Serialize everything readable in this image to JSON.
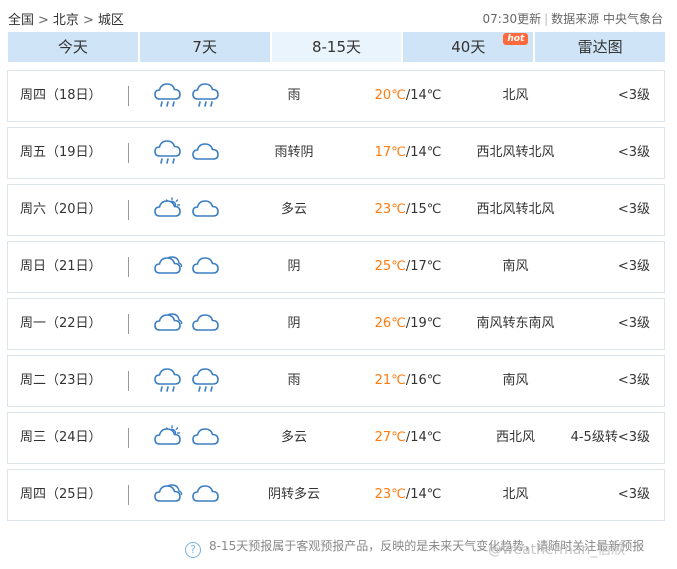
{
  "breadcrumb": {
    "items": [
      "全国",
      "北京",
      "城区"
    ],
    "sep": ">"
  },
  "meta": {
    "updated": "07:30更新",
    "source_label": "数据来源",
    "source": "中央气象台"
  },
  "tabs": [
    {
      "label": "今天",
      "active": false
    },
    {
      "label": "7天",
      "active": false
    },
    {
      "label": "8-15天",
      "active": true
    },
    {
      "label": "40天",
      "active": false,
      "badge": "hot"
    },
    {
      "label": "雷达图",
      "active": false
    }
  ],
  "days": [
    {
      "day": "周四（18日）",
      "icon1": "rain-cloud-icon",
      "icon2": "rain-cloud-icon",
      "weather": "雨",
      "high": "20℃",
      "low": "/14℃",
      "wind": "北风",
      "level": "<3级"
    },
    {
      "day": "周五（19日）",
      "icon1": "rain-cloud-icon",
      "icon2": "cloudy-night-icon",
      "weather": "雨转阴",
      "high": "17℃",
      "low": "/14℃",
      "wind": "西北风转北风",
      "level": "<3级"
    },
    {
      "day": "周六（20日）",
      "icon1": "partly-cloudy-day-icon",
      "icon2": "cloudy-night-icon",
      "weather": "多云",
      "high": "23℃",
      "low": "/15℃",
      "wind": "西北风转北风",
      "level": "<3级"
    },
    {
      "day": "周日（21日）",
      "icon1": "overcast-icon",
      "icon2": "cloudy-night-icon",
      "weather": "阴",
      "high": "25℃",
      "low": "/17℃",
      "wind": "南风",
      "level": "<3级"
    },
    {
      "day": "周一（22日）",
      "icon1": "overcast-icon",
      "icon2": "cloudy-night-icon",
      "weather": "阴",
      "high": "26℃",
      "low": "/19℃",
      "wind": "南风转东南风",
      "level": "<3级"
    },
    {
      "day": "周二（23日）",
      "icon1": "rain-cloud-icon",
      "icon2": "rain-cloud-icon",
      "weather": "雨",
      "high": "21℃",
      "low": "/16℃",
      "wind": "南风",
      "level": "<3级"
    },
    {
      "day": "周三（24日）",
      "icon1": "partly-cloudy-day-icon",
      "icon2": "cloudy-night-icon",
      "weather": "多云",
      "high": "27℃",
      "low": "/14℃",
      "wind": "西北风",
      "level": "4-5级转<3级"
    },
    {
      "day": "周四（25日）",
      "icon1": "overcast-icon",
      "icon2": "cloudy-night-icon",
      "weather": "阴转多云",
      "high": "23℃",
      "low": "/14℃",
      "wind": "北风",
      "level": "<3级"
    }
  ],
  "footer": {
    "note": "8-15天预报属于客观预报产品，反映的是未来天气变化趋势，请随时关注最新预报"
  },
  "watermark": "@weatherman_信欣",
  "colors": {
    "tab_bg": "#cfe4f6",
    "tab_active_bg": "#eaf4fc",
    "high_temp": "#ff7a0f",
    "icon_stroke": "#3d7fc2"
  }
}
